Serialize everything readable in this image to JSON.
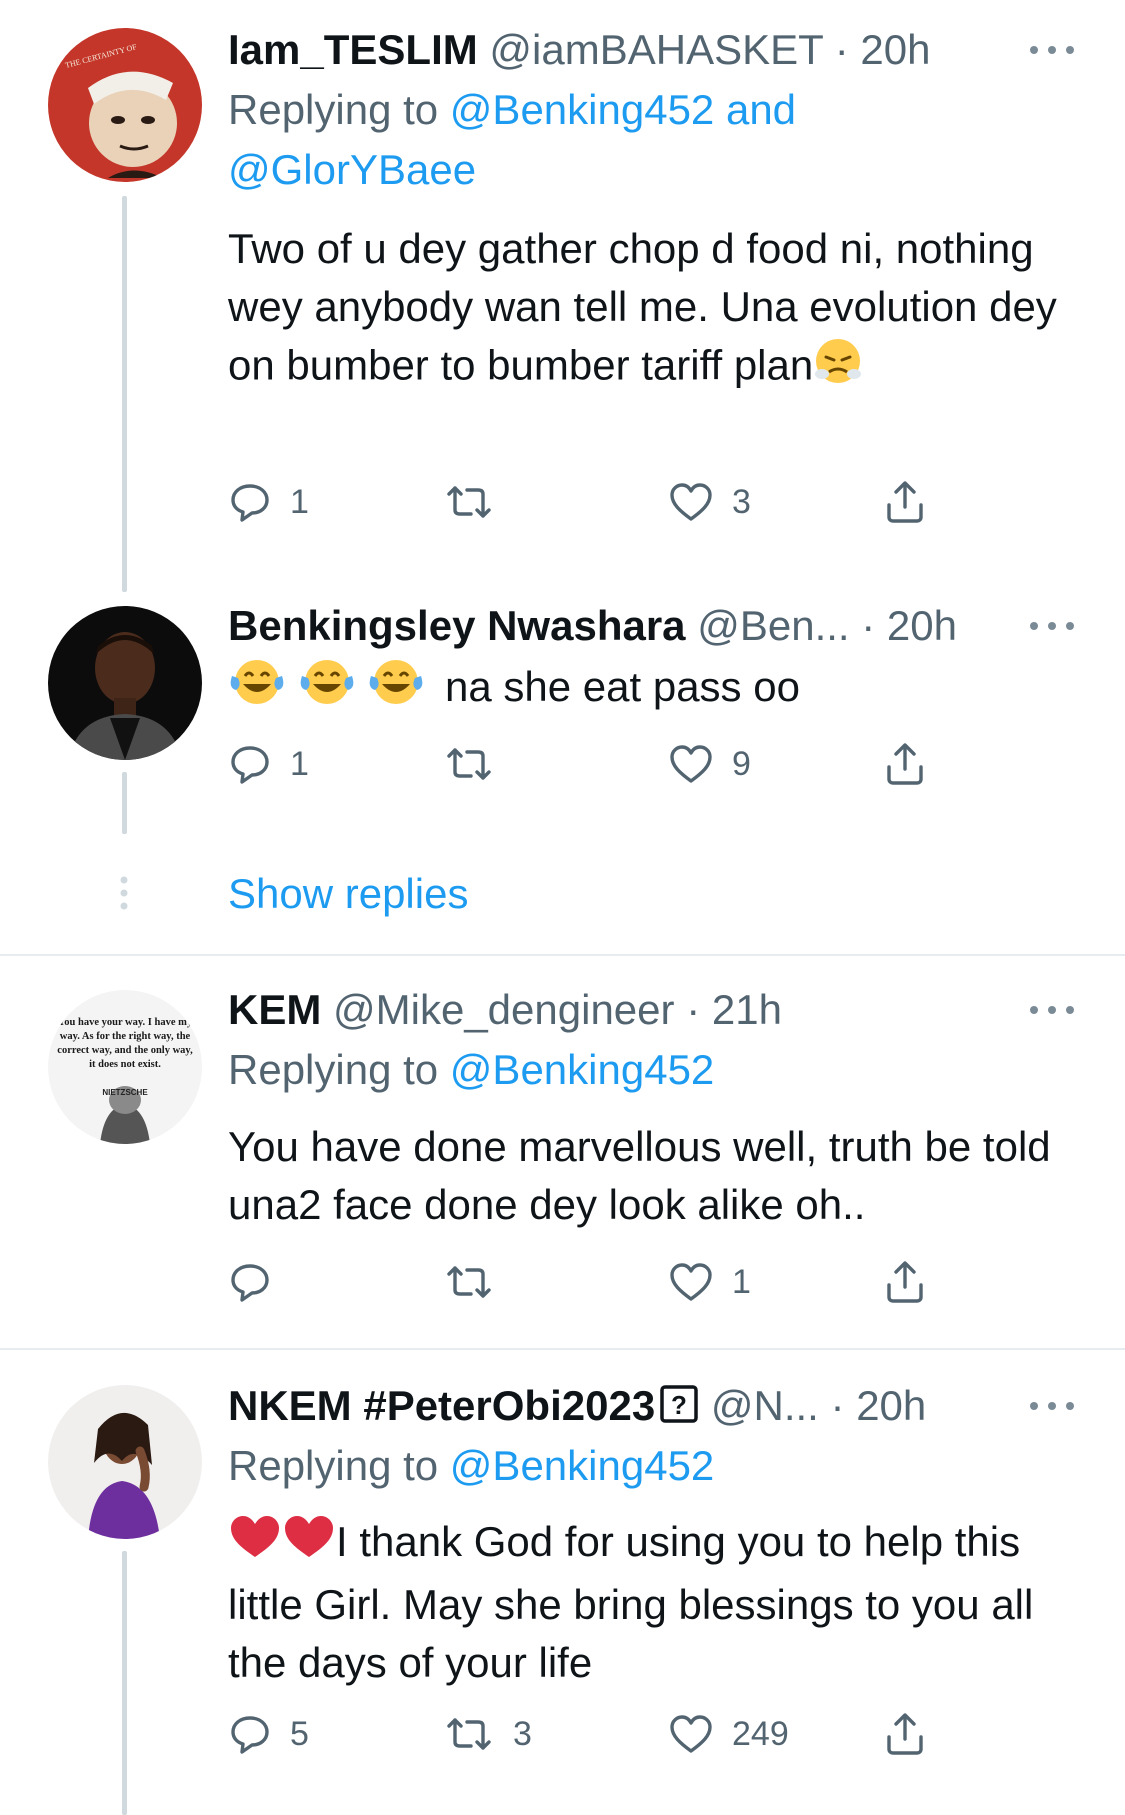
{
  "tweets": [
    {
      "name": "Iam_TESLIM",
      "handle": "@iamBAHASKET",
      "sep": "·",
      "time": "20h",
      "replying_prefix": "Replying to",
      "replying_to": "@Benking452",
      "replying_and": "and",
      "replying_to2": "@GlorYBaee",
      "text": "Two of u dey gather chop d food ni, nothing wey anybody wan tell me. Una evolution dey on bumber to bumber tariff plan",
      "emoji_end": "face-with-steam-emoji",
      "replies": "1",
      "retweets": "",
      "likes": "3"
    },
    {
      "name": "Benkingsley Nwashara",
      "handle": "@Ben...",
      "sep": "·",
      "time": "20h",
      "text": "na she eat pass oo",
      "emoji_start": "tears-of-joy-emoji x3",
      "replies": "1",
      "retweets": "",
      "likes": "9"
    },
    {
      "name": "KEM",
      "handle": "@Mike_dengineer",
      "sep": "·",
      "time": "21h",
      "replying_prefix": "Replying to",
      "replying_to": "@Benking452",
      "text": "You have done marvellous well, truth be told una2 face done dey look alike oh..",
      "replies": "",
      "retweets": "",
      "likes": "1",
      "avatar_text": "You have your way. I have my way. As for the right way, the correct way, and the only way, it does not exist.",
      "avatar_caption": "NIETZSCHE"
    },
    {
      "name": "NKEM #PeterObi2023",
      "name_icon": "question-box-icon",
      "handle": "@N...",
      "sep": "·",
      "time": "20h",
      "replying_prefix": "Replying to",
      "replying_to": "@Benking452",
      "text": "I thank God for using you to help this little Girl.  May she bring blessings to you all the days of your life",
      "emoji_start": "red-heart-emoji x2",
      "replies": "5",
      "retweets": "3",
      "likes": "249"
    }
  ],
  "show_replies": "Show replies",
  "avatar1_text": "THE CERTAINTY OF THE... LIKE HOPES SPRINGING HIGH STILL I'LL RISE",
  "colors": {
    "link": "#1d9bf0",
    "meta": "#536471",
    "line": "#cfd9de",
    "divider": "#e6ecf0"
  }
}
